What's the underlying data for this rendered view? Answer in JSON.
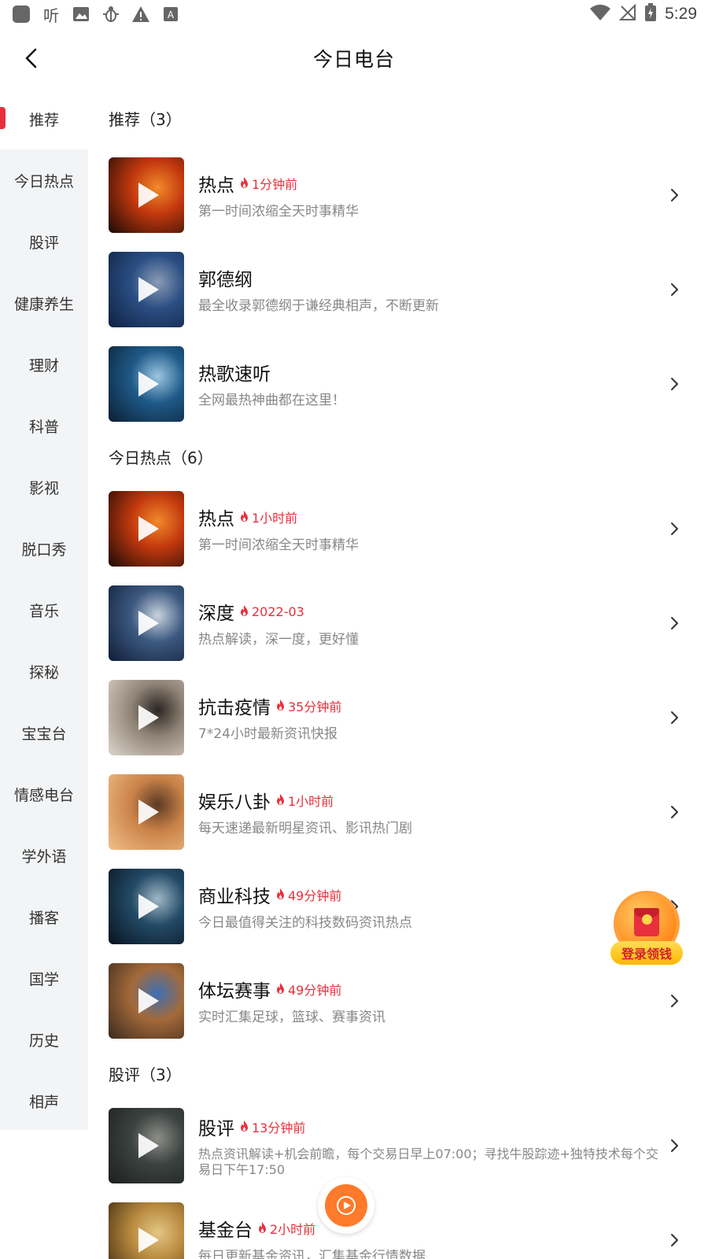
{
  "status_bar": {
    "time": "5:29",
    "app_icon_text": "听"
  },
  "header": {
    "title": "今日电台"
  },
  "sidebar": {
    "items": [
      {
        "label": "推荐",
        "active": true
      },
      {
        "label": "今日热点"
      },
      {
        "label": "股评"
      },
      {
        "label": "健康养生"
      },
      {
        "label": "理财"
      },
      {
        "label": "科普"
      },
      {
        "label": "影视"
      },
      {
        "label": "脱口秀"
      },
      {
        "label": "音乐"
      },
      {
        "label": "探秘"
      },
      {
        "label": "宝宝台"
      },
      {
        "label": "情感电台"
      },
      {
        "label": "学外语"
      },
      {
        "label": "播客"
      },
      {
        "label": "国学"
      },
      {
        "label": "历史"
      },
      {
        "label": "相声"
      }
    ]
  },
  "sections": [
    {
      "title": "推荐（3）",
      "items": [
        {
          "title": "热点",
          "badge": "1分钟前",
          "subtitle": "第一时间浓缩全天时事精华",
          "thumb": [
            "#1a0a05",
            "#c2380e",
            "#f28a2a"
          ]
        },
        {
          "title": "郭德纲",
          "badge": "",
          "subtitle": "最全收录郭德纲于谦经典相声，不断更新",
          "thumb": [
            "#0e2140",
            "#2b4e83",
            "#8a9bb5"
          ]
        },
        {
          "title": "热歌速听",
          "badge": "",
          "subtitle": "全网最热神曲都在这里！",
          "thumb": [
            "#0b1e33",
            "#1f5a88",
            "#9cc7e2"
          ]
        }
      ]
    },
    {
      "title": "今日热点（6）",
      "items": [
        {
          "title": "热点",
          "badge": "1小时前",
          "subtitle": "第一时间浓缩全天时事精华",
          "thumb": [
            "#1a0a05",
            "#c2380e",
            "#f28a2a"
          ]
        },
        {
          "title": "深度",
          "badge": "2022-03",
          "subtitle": "热点解读，深一度，更好懂",
          "thumb": [
            "#0f1d36",
            "#3c5980",
            "#c9d3df"
          ]
        },
        {
          "title": "抗击疫情",
          "badge": "35分钟前",
          "subtitle": "7*24小时最新资讯快报",
          "thumb": [
            "#ded6cc",
            "#8f8476",
            "#2b2622"
          ]
        },
        {
          "title": "娱乐八卦",
          "badge": "1小时前",
          "subtitle": "每天速递最新明星资讯、影讯热门剧",
          "thumb": [
            "#f1c089",
            "#c98248",
            "#5b3a24"
          ]
        },
        {
          "title": "商业科技",
          "badge": "49分钟前",
          "subtitle": "今日最值得关注的科技数码资讯热点",
          "thumb": [
            "#08121e",
            "#234a66",
            "#9fb8c7"
          ]
        },
        {
          "title": "体坛赛事",
          "badge": "49分钟前",
          "subtitle": "实时汇集足球，篮球、赛事资讯",
          "thumb": [
            "#3b2a1e",
            "#a36a3a",
            "#3e6fb4"
          ]
        }
      ]
    },
    {
      "title": "股评（3）",
      "items": [
        {
          "title": "股评",
          "badge": "13分钟前",
          "subtitle": "热点资讯解读+机会前瞻，每个交易日早上07:00；寻找牛股踪迹+独特技术每个交易日下午17:50",
          "thumb": [
            "#1c1f1e",
            "#3b4240",
            "#8e8e88"
          ]
        },
        {
          "title": "基金台",
          "badge": "2小时前",
          "subtitle": "每日更新基金资讯，汇集基金行情数据",
          "thumb": [
            "#3a2710",
            "#b88a3e",
            "#e3c684"
          ]
        }
      ]
    }
  ],
  "floating_bonus": {
    "label": "登录领钱"
  },
  "colors": {
    "accent": "#e8303c",
    "player": "#ff7a2a"
  }
}
